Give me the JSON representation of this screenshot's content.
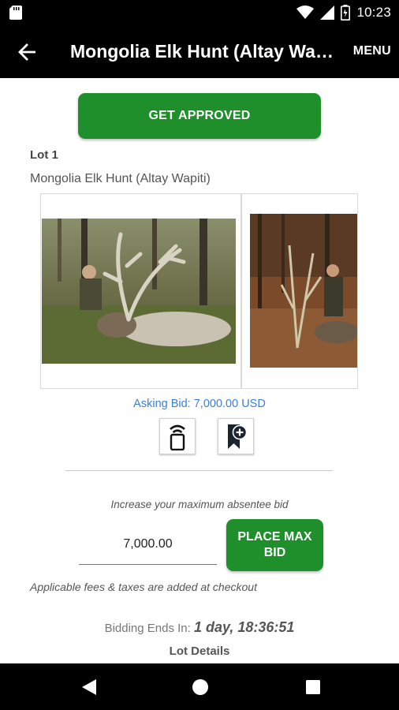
{
  "status_bar": {
    "time": "10:23",
    "icons": [
      "sd-card-icon",
      "wifi-icon",
      "signal-icon",
      "battery-icon"
    ]
  },
  "app_bar": {
    "title": "Mongolia Elk Hunt (Altay Wapiti)",
    "menu_label": "MENU",
    "back_icon": "arrow-left-icon"
  },
  "actions": {
    "get_approved_label": "GET APPROVED"
  },
  "lot": {
    "number_label": "Lot 1",
    "title": "Mongolia Elk Hunt (Altay Wapiti)",
    "images": [
      "elk-hunt-photo-1",
      "elk-hunt-photo-2"
    ],
    "asking_bid": "Asking Bid: 7,000.00 USD"
  },
  "bid_tools": {
    "remote_icon": "remote-bid-icon",
    "watch_icon": "bookmark-add-icon"
  },
  "bid": {
    "increase_label": "Increase your maximum absentee bid",
    "amount_value": "7,000.00",
    "place_label": "PLACE MAX BID",
    "fees_note": "Applicable fees & taxes are added at checkout"
  },
  "countdown": {
    "label": "Bidding Ends In:",
    "value": "1 day, 18:36:51"
  },
  "lot_details_label": "Lot Details",
  "nav_bar": {
    "icons": [
      "nav-back-icon",
      "nav-home-icon",
      "nav-recents-icon"
    ]
  },
  "colors": {
    "accent_green": "#1e8f2a",
    "link_blue": "#3d7fd4",
    "bar_black": "#000000"
  }
}
